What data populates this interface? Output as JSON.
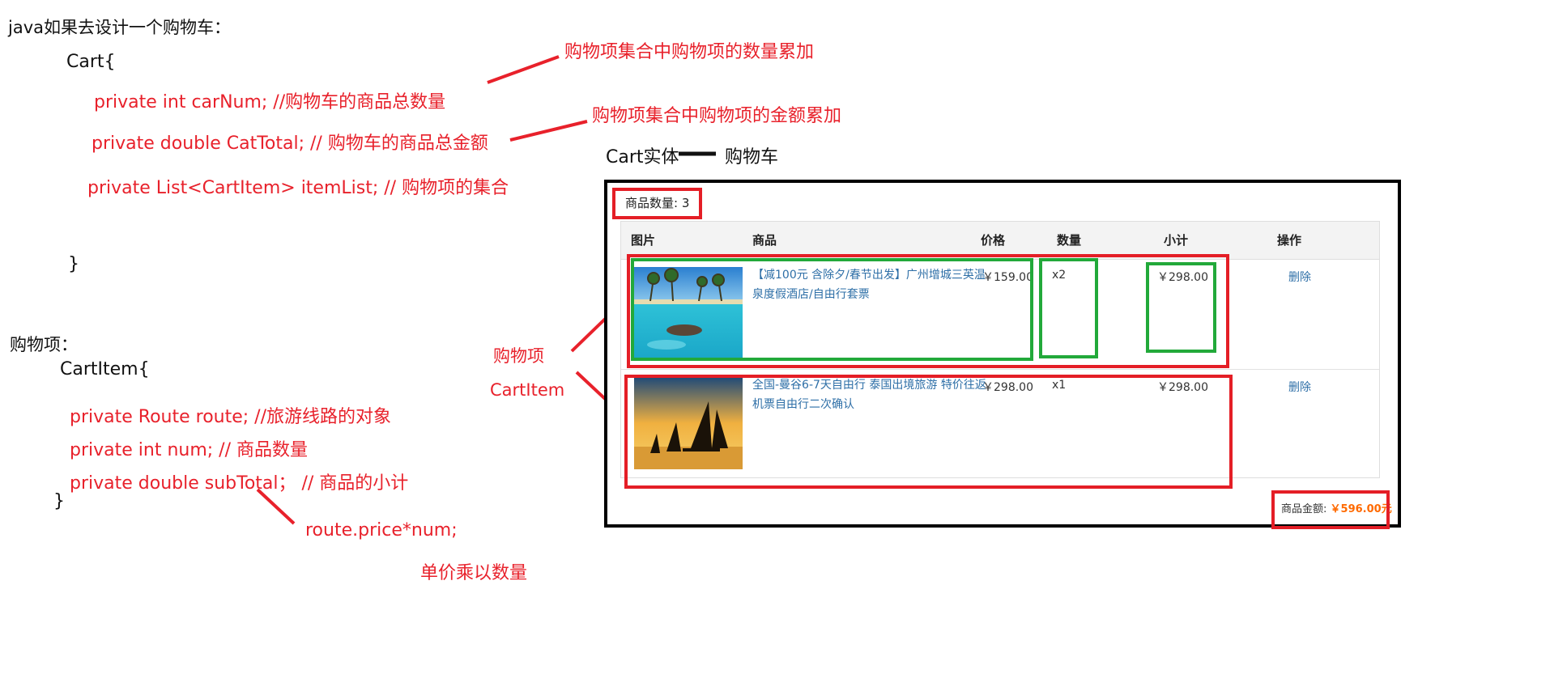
{
  "left": {
    "heading": "java如果去设计一个购物车：",
    "cart_open": "Cart{",
    "field1": "private int  carNum;      //购物车的商品总数量",
    "field2": "private double CatTotal;   // 购物车的商品总金额",
    "field3": "private List<CartItem> itemList; // 购物项的集合",
    "cart_close": "}",
    "item_heading": "购物项：",
    "item_open": "CartItem{",
    "item_field1": "private Route  route;   //旅游线路的对象",
    "item_field2": "private int num;   // 商品数量",
    "item_field3": "private double subTotal；  // 商品的小计",
    "item_close": "}",
    "formula": "route.price*num;",
    "formula_note": "单价乘以数量"
  },
  "annotations": {
    "count_sum": "购物项集合中购物项的数量累加",
    "amount_sum": "购物项集合中购物项的金额累加",
    "entity_label": "Cart实体",
    "entity_target": "购物车",
    "cartitem_cn": "购物项",
    "cartitem_en": "CartItem"
  },
  "cart": {
    "count_label": "商品数量:",
    "count_value": "3",
    "headers": [
      "图片",
      "商品",
      "价格",
      "数量",
      "小计",
      "操作"
    ],
    "rows": [
      {
        "title_line1": "【减100元 含除夕/春节出发】广州增城三英温",
        "title_line2": "泉度假酒店/自由行套票",
        "price": "￥159.00",
        "qty": "x2",
        "subtotal": "￥298.00",
        "action": "删除",
        "image": "tropical-beach-snorkel-image"
      },
      {
        "title_line1": "全国-曼谷6-7天自由行 泰国出境旅游 特价往返",
        "title_line2": "机票自由行二次确认",
        "price": "￥298.00",
        "qty": "x1",
        "subtotal": "￥298.00",
        "action": "删除",
        "image": "sailboats-sunset-image"
      }
    ],
    "total_label": "商品金额:",
    "total_value": "￥596.00元"
  },
  "colors": {
    "annotation_red": "#e8212b",
    "highlight_green": "#22a93a",
    "link_blue": "#2e6fa7",
    "total_orange": "#ff6a00"
  }
}
